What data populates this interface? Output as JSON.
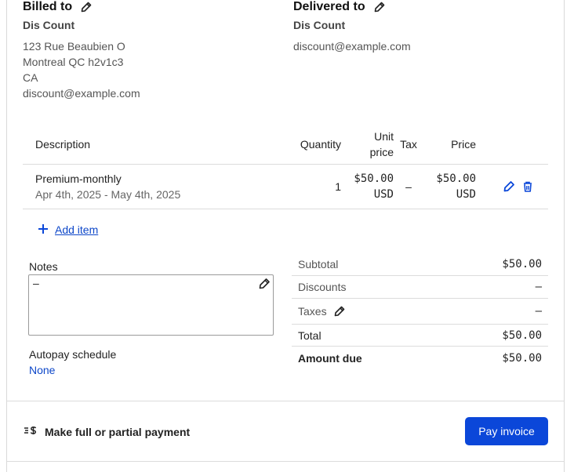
{
  "billed_to": {
    "title": "Billed to",
    "name": "Dis Count",
    "lines": [
      "123 Rue Beaubien O",
      "Montreal QC h2v1c3",
      "CA",
      "discount@example.com"
    ]
  },
  "delivered_to": {
    "title": "Delivered to",
    "name": "Dis Count",
    "lines": [
      "discount@example.com"
    ]
  },
  "items_table": {
    "headers": {
      "description": "Description",
      "quantity": "Quantity",
      "unit_price_1": "Unit",
      "unit_price_2": "price",
      "tax": "Tax",
      "price": "Price"
    },
    "rows": [
      {
        "name": "Premium-monthly",
        "dates": "Apr 4th, 2025 - May 4th, 2025",
        "quantity": "1",
        "unit_price": "$50.00",
        "unit_currency": "USD",
        "tax": "–",
        "price": "$50.00",
        "price_currency": "USD"
      }
    ]
  },
  "add_item": {
    "label": "Add item"
  },
  "notes": {
    "label": "Notes",
    "value": "–"
  },
  "autopay": {
    "label": "Autopay schedule",
    "value": "None"
  },
  "totals": {
    "subtotal_label": "Subtotal",
    "subtotal": "$50.00",
    "discounts_label": "Discounts",
    "discounts": "–",
    "taxes_label": "Taxes",
    "taxes": "–",
    "total_label": "Total",
    "total": "$50.00",
    "amount_due_label": "Amount due",
    "amount_due": "$50.00"
  },
  "payment": {
    "label": "Make full or partial payment",
    "button": "Pay invoice"
  },
  "colors": {
    "accent": "#0b47d9",
    "link": "#0d47c9",
    "border": "#dcdcdc"
  },
  "icons": [
    "pencil-icon",
    "trash-icon",
    "plus-icon",
    "payment-speed-icon"
  ]
}
